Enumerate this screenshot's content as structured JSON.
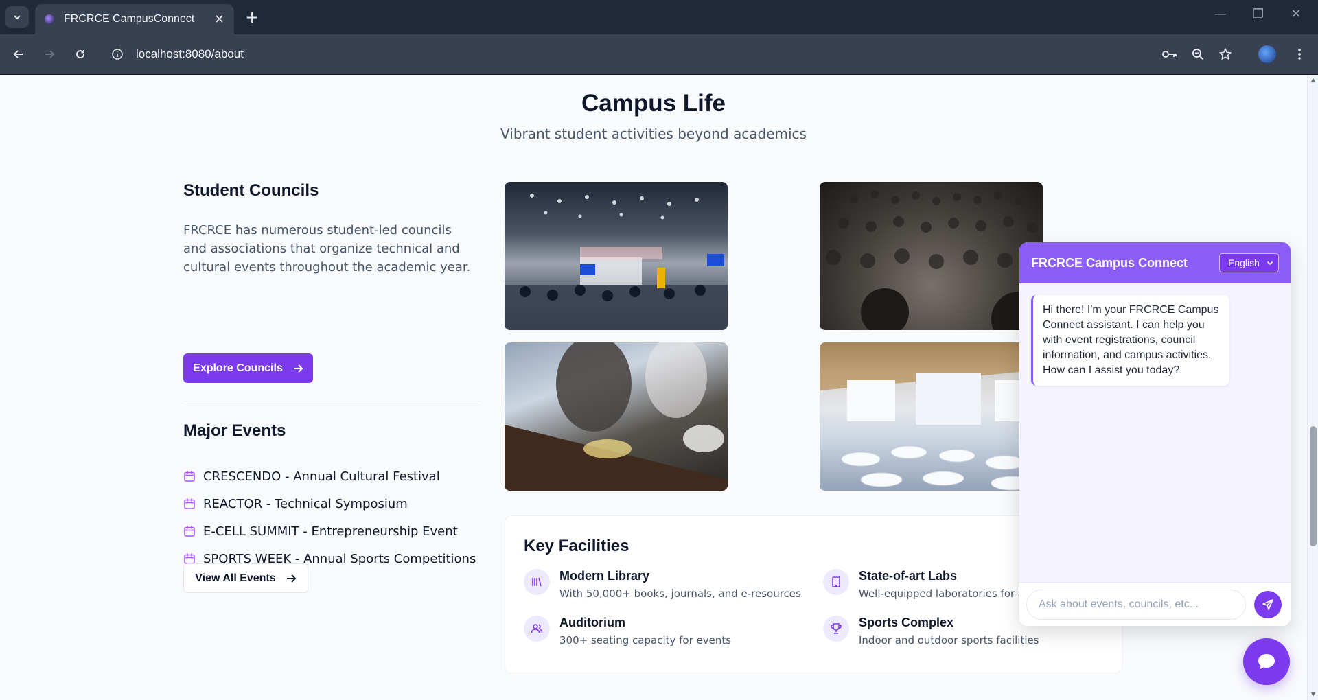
{
  "browser": {
    "tab_title": "FRCRCE CampusConnect",
    "url": "localhost:8080/about"
  },
  "section": {
    "title": "Campus Life",
    "subtitle": "Vibrant student activities beyond academics"
  },
  "councils": {
    "title": "Student Councils",
    "description": "FRCRCE has numerous student-led councils and associations that organize technical and cultural events throughout the academic year.",
    "button_label": "Explore Councils"
  },
  "events": {
    "title": "Major Events",
    "items": [
      "CRESCENDO - Annual Cultural Festival",
      "REACTOR - Technical Symposium",
      "E-CELL SUMMIT - Entrepreneurship Event",
      "SPORTS WEEK - Annual Sports Competitions"
    ],
    "button_label": "View All Events"
  },
  "facilities": {
    "title": "Key Facilities",
    "items": [
      {
        "name": "Modern Library",
        "description": "With 50,000+ books, journals, and e-resources",
        "icon": "library-icon"
      },
      {
        "name": "State-of-art Labs",
        "description": "Well-equipped laboratories for all",
        "icon": "building-icon"
      },
      {
        "name": "Auditorium",
        "description": "300+ seating capacity for events",
        "icon": "users-icon"
      },
      {
        "name": "Sports Complex",
        "description": "Indoor and outdoor sports facilities",
        "icon": "trophy-icon"
      }
    ]
  },
  "chat": {
    "title": "FRCRCE Campus Connect",
    "language": "English",
    "welcome_message": "Hi there! I'm your FRCRCE Campus Connect assistant. I can help you with event registrations, council information, and campus activities. How can I assist you today?",
    "input_placeholder": "Ask about events, councils, etc..."
  },
  "colors": {
    "accent": "#7c3aed",
    "chat_header": "#8b5cf6"
  }
}
